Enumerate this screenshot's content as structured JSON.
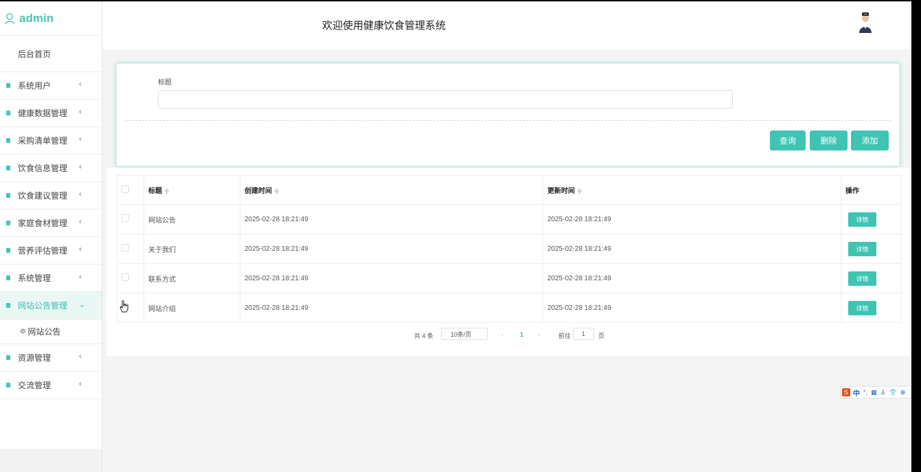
{
  "app": {
    "brand": "admin",
    "header_title": "欢迎使用健康饮食管理系统"
  },
  "sidebar": {
    "home": "后台首页",
    "items": [
      {
        "label": "系统用户",
        "arrow": "‹"
      },
      {
        "label": "健康数据管理",
        "arrow": "‹"
      },
      {
        "label": "采购清单管理",
        "arrow": "‹"
      },
      {
        "label": "饮食信息管理",
        "arrow": "‹"
      },
      {
        "label": "饮食建议管理",
        "arrow": "‹"
      },
      {
        "label": "家庭食材管理",
        "arrow": "‹"
      },
      {
        "label": "营养评估管理",
        "arrow": "‹"
      },
      {
        "label": "系统管理",
        "arrow": "‹"
      },
      {
        "label": "网站公告管理",
        "arrow": "⌄"
      },
      {
        "label": "资源管理",
        "arrow": "‹"
      },
      {
        "label": "交流管理",
        "arrow": "‹"
      }
    ],
    "sub_item": "网站公告",
    "sub_icon": "⊘"
  },
  "search": {
    "label": "标题",
    "value": "",
    "placeholder": ""
  },
  "buttons": {
    "query": "查询",
    "delete": "删除",
    "add": "添加"
  },
  "table": {
    "headers": {
      "title": "标题",
      "created": "创建时间",
      "updated": "更新时间",
      "ops": "操作"
    },
    "sort_icon": "≑",
    "detail_label": "详情",
    "rows": [
      {
        "title": "网站公告",
        "created": "2025-02-28 18:21:49",
        "updated": "2025-02-28 18:21:49"
      },
      {
        "title": "关于我们",
        "created": "2025-02-28 18:21:49",
        "updated": "2025-02-28 18:21:49"
      },
      {
        "title": "联系方式",
        "created": "2025-02-28 18:21:49",
        "updated": "2025-02-28 18:21:49"
      },
      {
        "title": "网站介绍",
        "created": "2025-02-28 18:21:49",
        "updated": "2025-02-28 18:21:49"
      }
    ]
  },
  "pager": {
    "total": "共 4 条",
    "page_size": "10条/页",
    "prev": "‹",
    "current": "1",
    "next": "›",
    "goto": "前往",
    "goto_value": "1",
    "page_unit": "页"
  },
  "ime": {
    "logo": "S",
    "lang": "中",
    "icons": [
      "°,",
      "▦",
      "♙",
      "👕",
      "⊕"
    ]
  },
  "colors": {
    "accent": "#3fc3b3",
    "brand_text": "#4fc3b5"
  }
}
